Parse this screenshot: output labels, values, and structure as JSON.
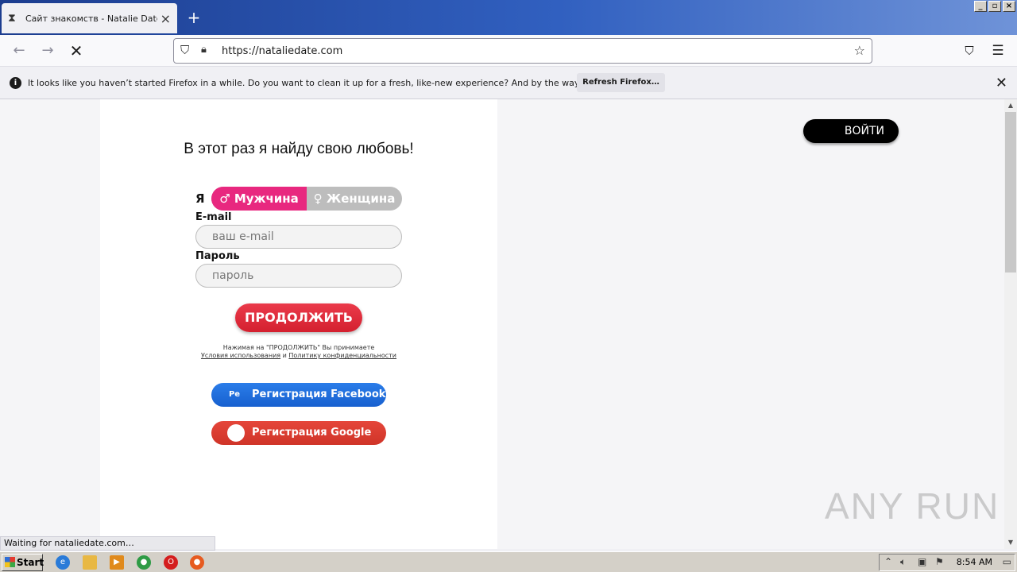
{
  "browser": {
    "tab": {
      "title": "Сайт знакомств - Natalie Date. Знакомства",
      "icon": "hourglass-icon"
    },
    "url": "https://nataliedate.com",
    "notification": {
      "message": "It looks like you haven’t started Firefox in a while. Do you want to clean it up for a fresh, like-new experience? And by the way, welcome back!",
      "button": "Refresh Firefox…"
    },
    "status": "Waiting for nataliedate.com…"
  },
  "page": {
    "headline": "В этот раз я найду свою любовь!",
    "gender_label": "Я",
    "gender": {
      "male": "♂ Мужчина",
      "female": "♀ Женщина",
      "selected": "male"
    },
    "email_label": "E-mail",
    "email_placeholder": "ваш e-mail",
    "password_label": "Пароль",
    "password_placeholder": "пароль",
    "continue_button": "ПРОДОЛЖИТЬ",
    "terms_text": "Нажимая на \"ПРОДОЛЖИТЬ\" Вы принимаете",
    "terms_link": "Условия использования",
    "terms_and": "и",
    "privacy_link": "Политику конфиденциальности",
    "facebook_button": "Регистрация Facebook",
    "facebook_icon_text": "Pe",
    "google_button": "Регистрация Google",
    "login_button": "ВОЙТИ"
  },
  "watermark": "ANY RUN",
  "taskbar": {
    "start": "Start",
    "time": "8:54 AM",
    "colors": {
      "ie": "#2a7bd8",
      "explorer": "#e8b844",
      "media": "#e08a1c",
      "chrome": "#2e9b45",
      "opera": "#d41e1e",
      "firefox": "#e65b20"
    }
  }
}
